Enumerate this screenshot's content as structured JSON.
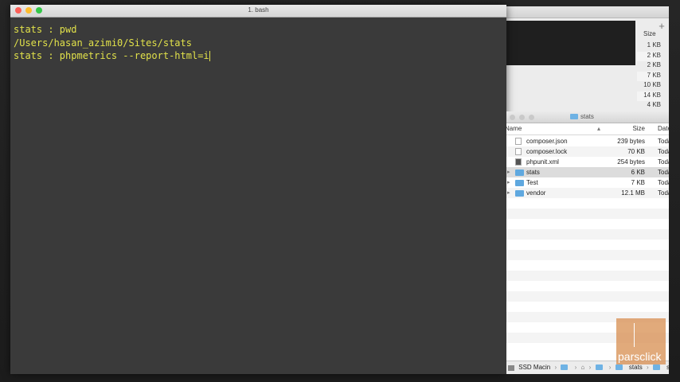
{
  "terminal": {
    "title": "1. bash",
    "lines": [
      "stats : pwd",
      "/Users/hasan_azimi0/Sites/stats",
      "stats : phpmetrics --report-html=i"
    ]
  },
  "background_window": {
    "size_header": "Size",
    "sizes": [
      "1 KB",
      "2 KB",
      "2 KB",
      "7 KB",
      "10 KB",
      "14 KB",
      "4 KB"
    ]
  },
  "finder": {
    "title": "stats",
    "columns": {
      "name": "Name",
      "size": "Size",
      "date": "Date"
    },
    "rows": [
      {
        "name": "composer.json",
        "size": "239 bytes",
        "date": "Today",
        "type": "file"
      },
      {
        "name": "composer.lock",
        "size": "70 KB",
        "date": "Today",
        "type": "file"
      },
      {
        "name": "phpunit.xml",
        "size": "254 bytes",
        "date": "Today",
        "type": "xml"
      },
      {
        "name": "stats",
        "size": "6 KB",
        "date": "Today",
        "type": "folder"
      },
      {
        "name": "Test",
        "size": "7 KB",
        "date": "Today",
        "type": "folder"
      },
      {
        "name": "vendor",
        "size": "12.1 MB",
        "date": "Today",
        "type": "folder"
      }
    ],
    "pathbar": {
      "disk": "SSD Macin",
      "crumbs": [
        "stats",
        "stats"
      ]
    }
  },
  "watermark": {
    "text": "parsclick"
  }
}
